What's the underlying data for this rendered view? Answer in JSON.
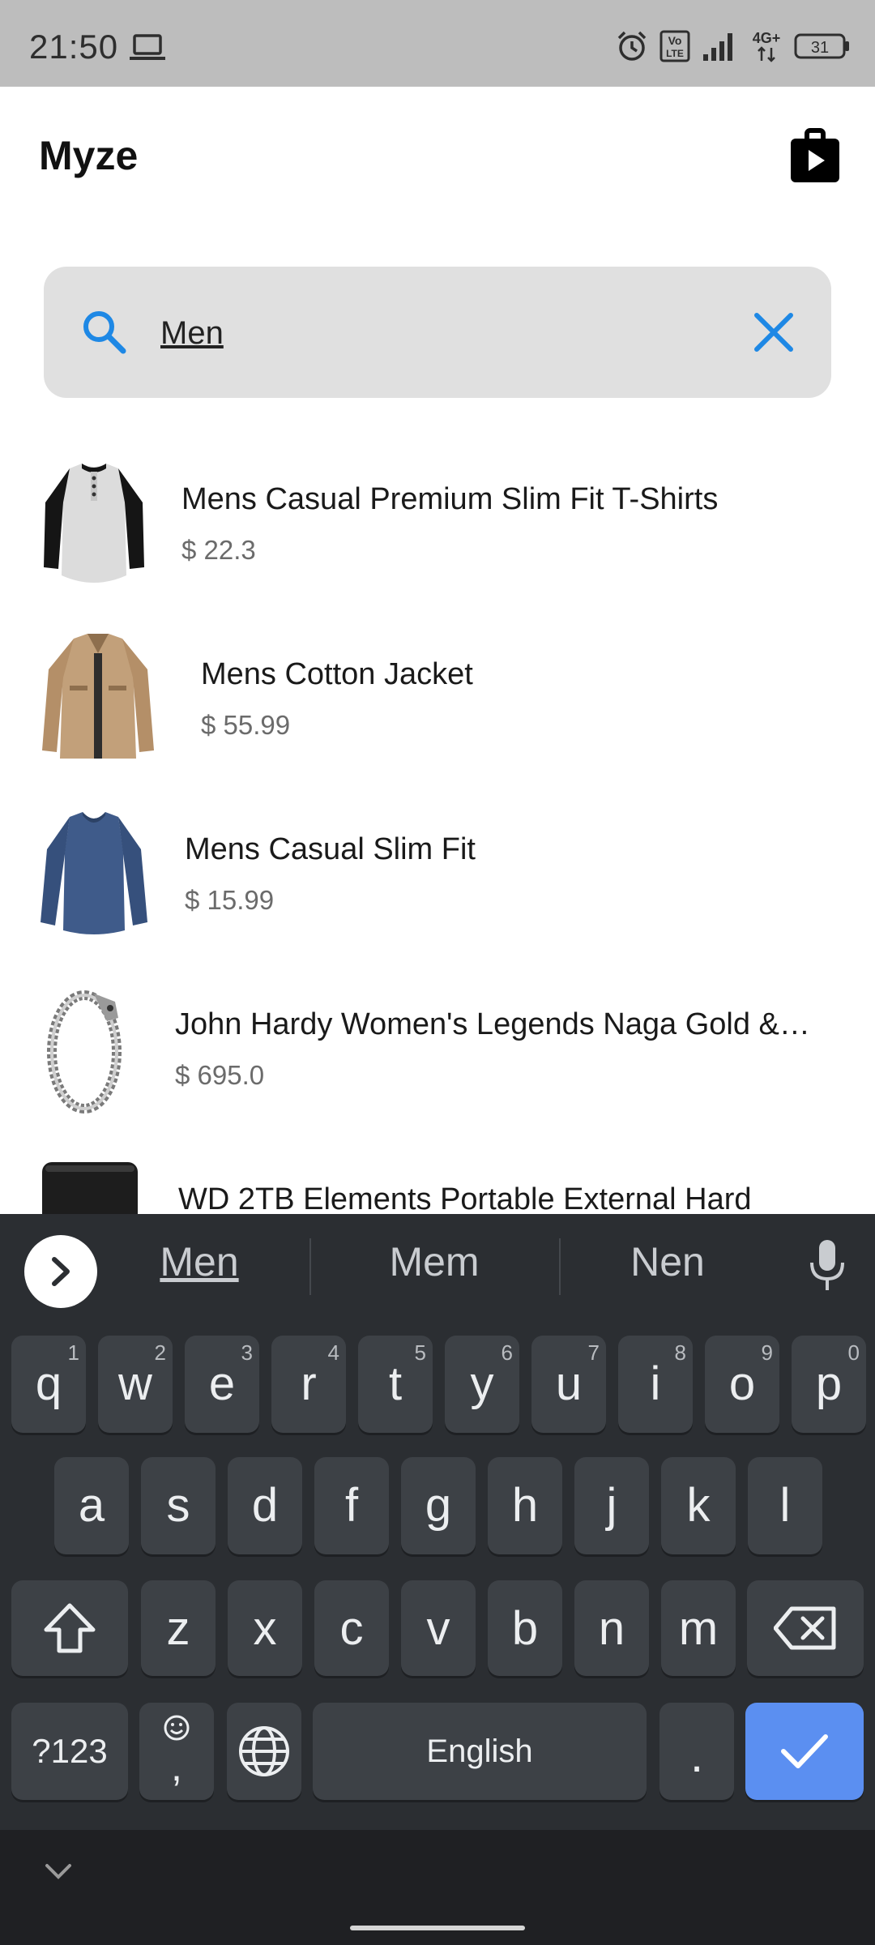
{
  "status_bar": {
    "time": "21:50",
    "network": "4G+",
    "volte": "Vo LTE",
    "battery": "31",
    "icons": [
      "laptop-icon",
      "alarm-icon",
      "volte-icon",
      "signal-icon",
      "network-4g-icon",
      "battery-icon"
    ]
  },
  "header": {
    "title": "Myze",
    "store_icon": "shopping-bag-play-icon"
  },
  "search": {
    "value": "Men",
    "placeholder": "",
    "accent_color": "#1e88e5"
  },
  "products": [
    {
      "name": "Mens Casual Premium Slim Fit T-Shirts",
      "price": "$ 22.3",
      "thumb": "raglan-henley-shirt"
    },
    {
      "name": "Mens Cotton Jacket",
      "price": "$ 55.99",
      "thumb": "khaki-jacket"
    },
    {
      "name": "Mens Casual Slim Fit",
      "price": "$ 15.99",
      "thumb": "blue-long-sleeve-shirt"
    },
    {
      "name": "John Hardy Women's Legends Naga Gold &…",
      "price": "$ 695.0",
      "thumb": "dragon-chain-bracelet"
    },
    {
      "name": "WD 2TB Elements Portable External Hard",
      "price": "",
      "thumb": "black-hard-drive"
    }
  ],
  "keyboard": {
    "suggestions": [
      "Men",
      "Mem",
      "Nen"
    ],
    "row1": [
      {
        "k": "q",
        "h": "1"
      },
      {
        "k": "w",
        "h": "2"
      },
      {
        "k": "e",
        "h": "3"
      },
      {
        "k": "r",
        "h": "4"
      },
      {
        "k": "t",
        "h": "5"
      },
      {
        "k": "y",
        "h": "6"
      },
      {
        "k": "u",
        "h": "7"
      },
      {
        "k": "i",
        "h": "8"
      },
      {
        "k": "o",
        "h": "9"
      },
      {
        "k": "p",
        "h": "0"
      }
    ],
    "row2": [
      "a",
      "s",
      "d",
      "f",
      "g",
      "h",
      "j",
      "k",
      "l"
    ],
    "row3": [
      "z",
      "x",
      "c",
      "v",
      "b",
      "n",
      "m"
    ],
    "symbols_label": "?123",
    "comma_label": ",",
    "space_label": "English",
    "period_label": ".",
    "colors": {
      "background": "#2b2e32",
      "key": "#3d4146",
      "enter": "#5b8ff1"
    }
  }
}
